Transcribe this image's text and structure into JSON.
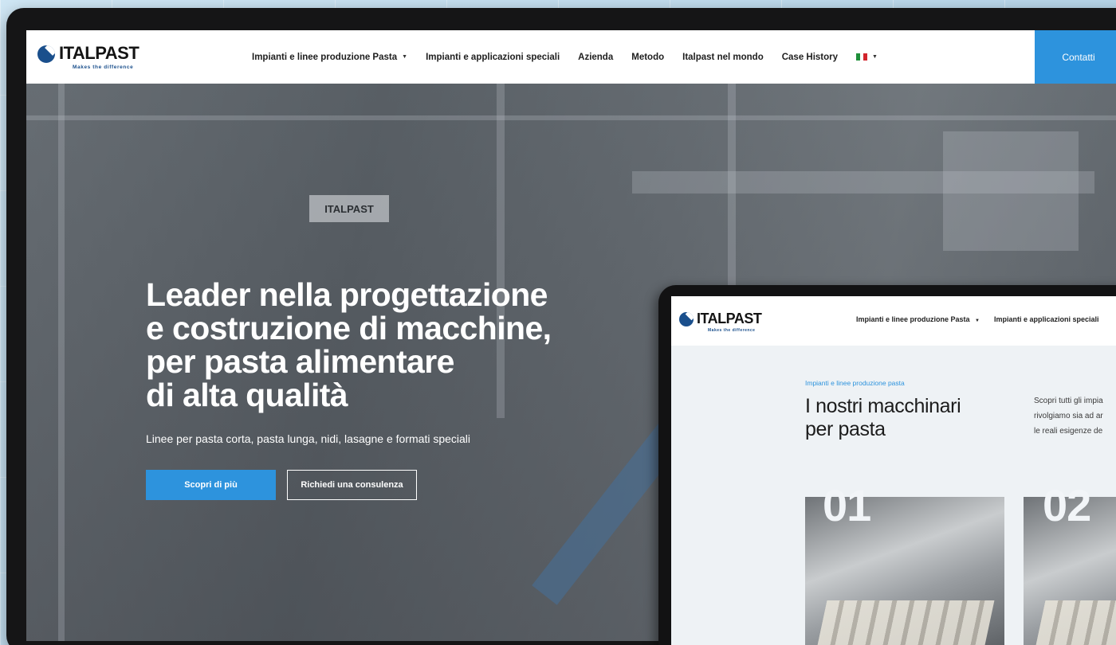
{
  "site": {
    "logo_text": "ITALPAST",
    "logo_tagline": "Makes the difference"
  },
  "nav": {
    "items": [
      {
        "label": "Impianti e linee produzione Pasta",
        "has_dropdown": true
      },
      {
        "label": "Impianti e applicazioni speciali",
        "has_dropdown": false
      },
      {
        "label": "Azienda",
        "has_dropdown": false
      },
      {
        "label": "Metodo",
        "has_dropdown": false
      },
      {
        "label": "Italpast nel mondo",
        "has_dropdown": false
      },
      {
        "label": "Case History",
        "has_dropdown": false
      }
    ],
    "language_flag": "italy-flag-icon",
    "contact_label": "Contatti"
  },
  "hero": {
    "headline_lines": [
      "Leader nella progettazione",
      "e costruzione di macchine,",
      "per pasta alimentare",
      "di alta qualità"
    ],
    "subline": "Linee per pasta corta, pasta lunga, nidi, lasagne e formati speciali",
    "primary_button": "Scopri di più",
    "secondary_button": "Richiedi una consulenza",
    "machine_label": "ITALPAST"
  },
  "tablet": {
    "nav_items": [
      "Impianti e linee produzione Pasta",
      "Impianti e applicazioni speciali"
    ],
    "breadcrumb": "Impianti e linee produzione pasta",
    "title_lines": [
      "I nostri macchinari",
      "per pasta"
    ],
    "description_lines": [
      "Scopri tutti gli impia",
      "rivolgiamo sia ad ar",
      "le reali esigenze de"
    ],
    "cards": [
      {
        "number": "01"
      },
      {
        "number": "02"
      }
    ]
  },
  "colors": {
    "accent": "#2d93dd",
    "brand_blue": "#1a4f8c",
    "frame": "#151516",
    "flag_green": "#1e8f3a",
    "flag_white": "#ffffff",
    "flag_red": "#d2252c"
  }
}
